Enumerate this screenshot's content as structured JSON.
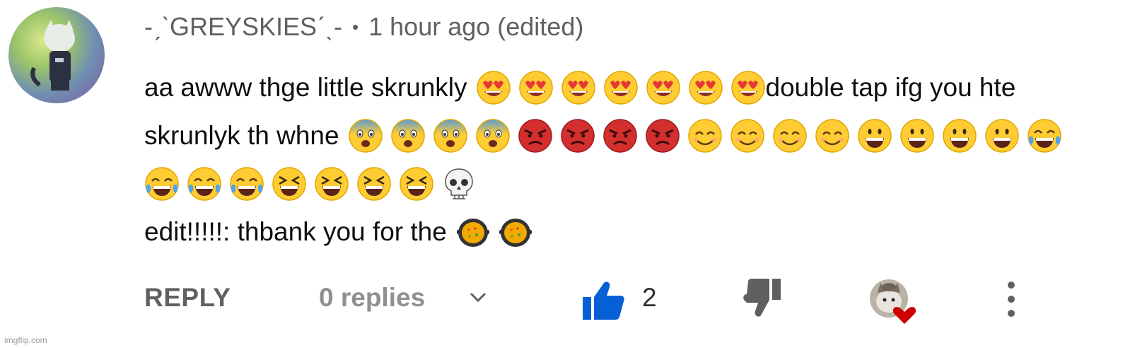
{
  "comment": {
    "author": "-ˏˋGREYSKIESˊˎ-",
    "separator": "•",
    "timestamp": "1 hour ago (edited)",
    "lines": [
      {
        "text": "aa awww thge little skrunkly",
        "tail": "double tap ifg you hte"
      },
      {
        "text": "skrunlyk th whne"
      },
      {
        "text": ""
      },
      {
        "text": "edit!!!!!: thbank you for the"
      }
    ],
    "emoji_names": {
      "line1": "heart-eyes-emoji",
      "line2_a": "fearful-emoji",
      "line2_b": "angry-emoji",
      "line2_c": "smiling-emoji",
      "line2_d": "grinning-emoji",
      "line2_e": "tears-of-joy-emoji",
      "line3_a": "tears-of-joy-emoji",
      "line3_b": "squinting-laughing-emoji",
      "line3_c": "skull-emoji",
      "line4": "paella-pan-emoji"
    }
  },
  "actions": {
    "reply_label": "REPLY",
    "replies_label": "0 replies",
    "like_count": "2",
    "icons": [
      "chevron-down-icon",
      "thumbs-up-icon",
      "thumbs-down-icon",
      "creator-heart-icon",
      "more-vertical-icon"
    ]
  },
  "watermark": "imgflip.com",
  "colors": {
    "accent_blue": "#065fd4",
    "meta_gray": "#606060",
    "muted_gray": "#909090",
    "text_dark": "#0f0f0f",
    "heart_red": "#cc0000"
  }
}
